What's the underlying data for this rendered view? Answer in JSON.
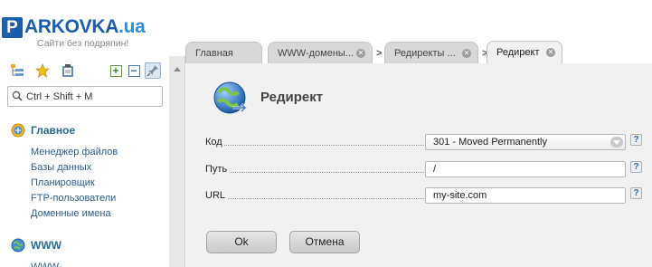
{
  "brand": {
    "logo_letter": "P",
    "name": "ARKOVKA",
    "domain": ".ua",
    "slogan": "Сайти без подряпин!"
  },
  "search": {
    "value": "Ctrl + Shift + M",
    "placeholder": ""
  },
  "sidebar": {
    "sections": [
      {
        "title": "Главное",
        "items": [
          "Менеджер файлов",
          "Базы данных",
          "Планировщик",
          "FTP-пользователи",
          "Доменные имена"
        ]
      },
      {
        "title": "WWW",
        "items": [
          "WWW-..."
        ]
      }
    ]
  },
  "tabs": [
    {
      "label": "Главная",
      "closable": false,
      "active": false
    },
    {
      "label": "WWW-домены...",
      "closable": true,
      "active": false
    },
    {
      "label": "Редиректы ...",
      "closable": true,
      "active": false
    },
    {
      "label": "Редирект",
      "closable": true,
      "active": true
    }
  ],
  "tab_separator": ">",
  "form": {
    "title": "Редирект",
    "fields": [
      {
        "label": "Код",
        "value": "301 - Moved Permanently",
        "kind": "select"
      },
      {
        "label": "Путь",
        "value": "/",
        "kind": "text"
      },
      {
        "label": "URL",
        "value": "my-site.com",
        "kind": "text"
      }
    ],
    "help_label": "?",
    "ok_label": "Ok",
    "cancel_label": "Отмена"
  },
  "colors": {
    "brand": "#1b5da8",
    "link": "#2e5f88",
    "panel": "#f1f1f1",
    "tab": "#d8d8d8"
  }
}
